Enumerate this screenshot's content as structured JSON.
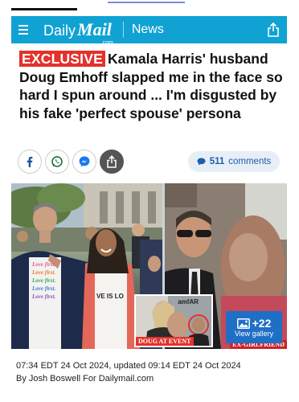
{
  "app": {
    "brand_daily": "Daily",
    "brand_mail": "Mail",
    "brand_com": ".com",
    "section": "News"
  },
  "article": {
    "badge": "EXCLUSIVE",
    "headline": "Kamala Harris' husband Doug Emhoff slapped me in the face so hard I spun around ... I'm disgusted by his fake 'perfect spouse' persona",
    "comments_count": "511",
    "comments_label": "comments",
    "photo": {
      "shirt_text": "Love first. Love first. Love first. Love first. Love first.",
      "shirt_text_right": "VE IS LO",
      "inset_caption": "DOUG AT EVENT",
      "inset_logo": "amfAR",
      "right_caption": "EX-GIRLFRIEND",
      "gallery_count": "+22",
      "gallery_label": "View gallery"
    },
    "byline_dates": "07:34 EDT 24 Oct 2024, updated 09:14 EDT 24 Oct 2024",
    "byline_author": "By Josh Boswell For Dailymail.com"
  },
  "share": {
    "icons": [
      "facebook-icon",
      "whatsapp-icon",
      "messenger-icon",
      "share-icon"
    ]
  },
  "colors": {
    "topbar": "#10a2d3",
    "exclusive_badge": "#e4322b",
    "comments_text": "#1a5fb0",
    "gallery": "#1f6fc6"
  }
}
